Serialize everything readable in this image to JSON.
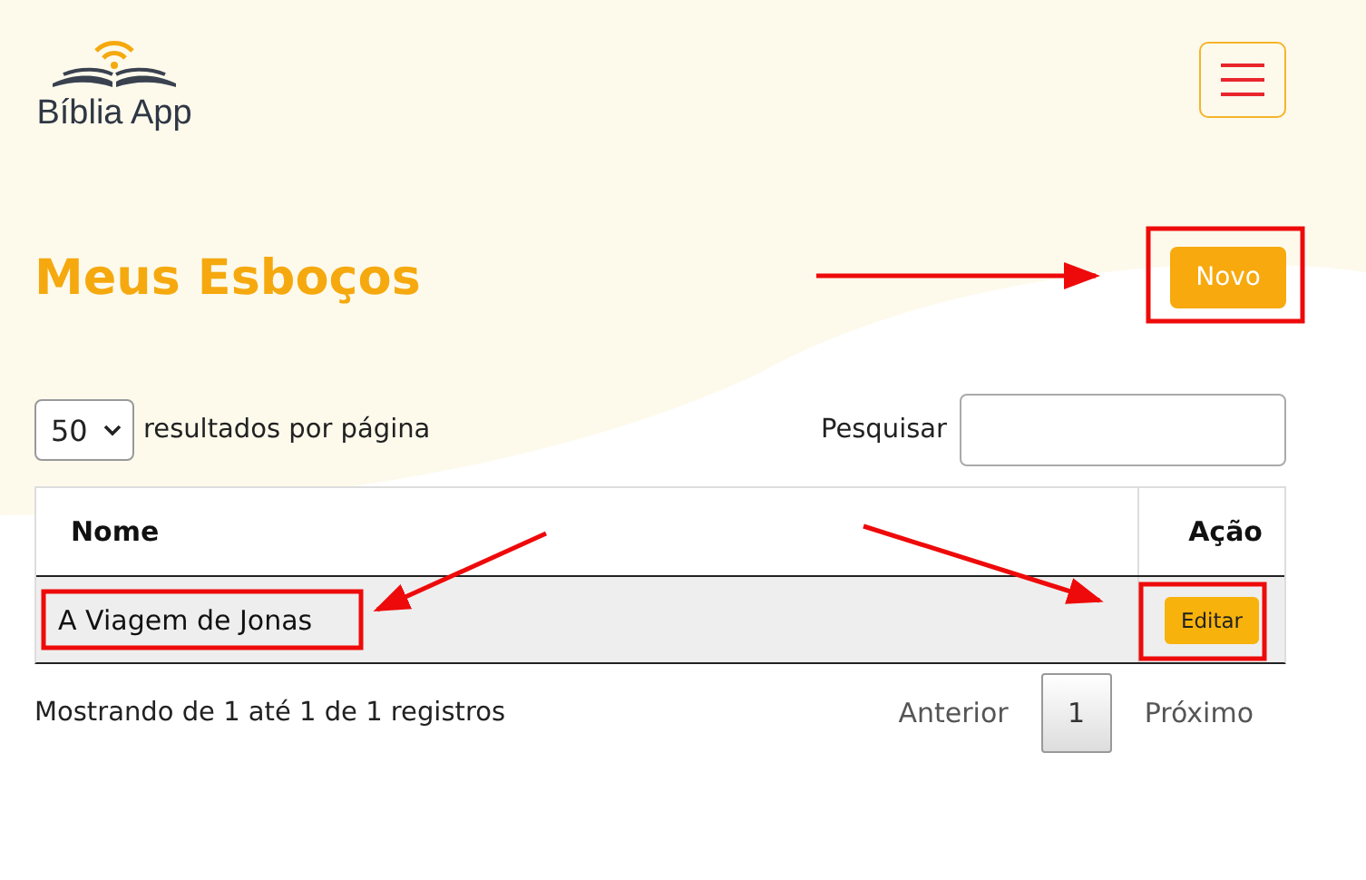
{
  "brand": {
    "name": "Bíblia App"
  },
  "page": {
    "title": "Meus Esboços",
    "new_button": "Novo"
  },
  "controls": {
    "page_size": "50",
    "page_size_label": "resultados por página",
    "search_label": "Pesquisar"
  },
  "table": {
    "columns": [
      "Nome",
      "Ação"
    ],
    "rows": [
      {
        "name": "A Viagem de Jonas",
        "action": "Editar",
        "highlighted": true
      }
    ]
  },
  "footer": {
    "info": "Mostrando de 1 até 1 de 1 registros",
    "previous": "Anterior",
    "pages": [
      {
        "label": "1",
        "selected": true
      }
    ],
    "next": "Próximo"
  }
}
